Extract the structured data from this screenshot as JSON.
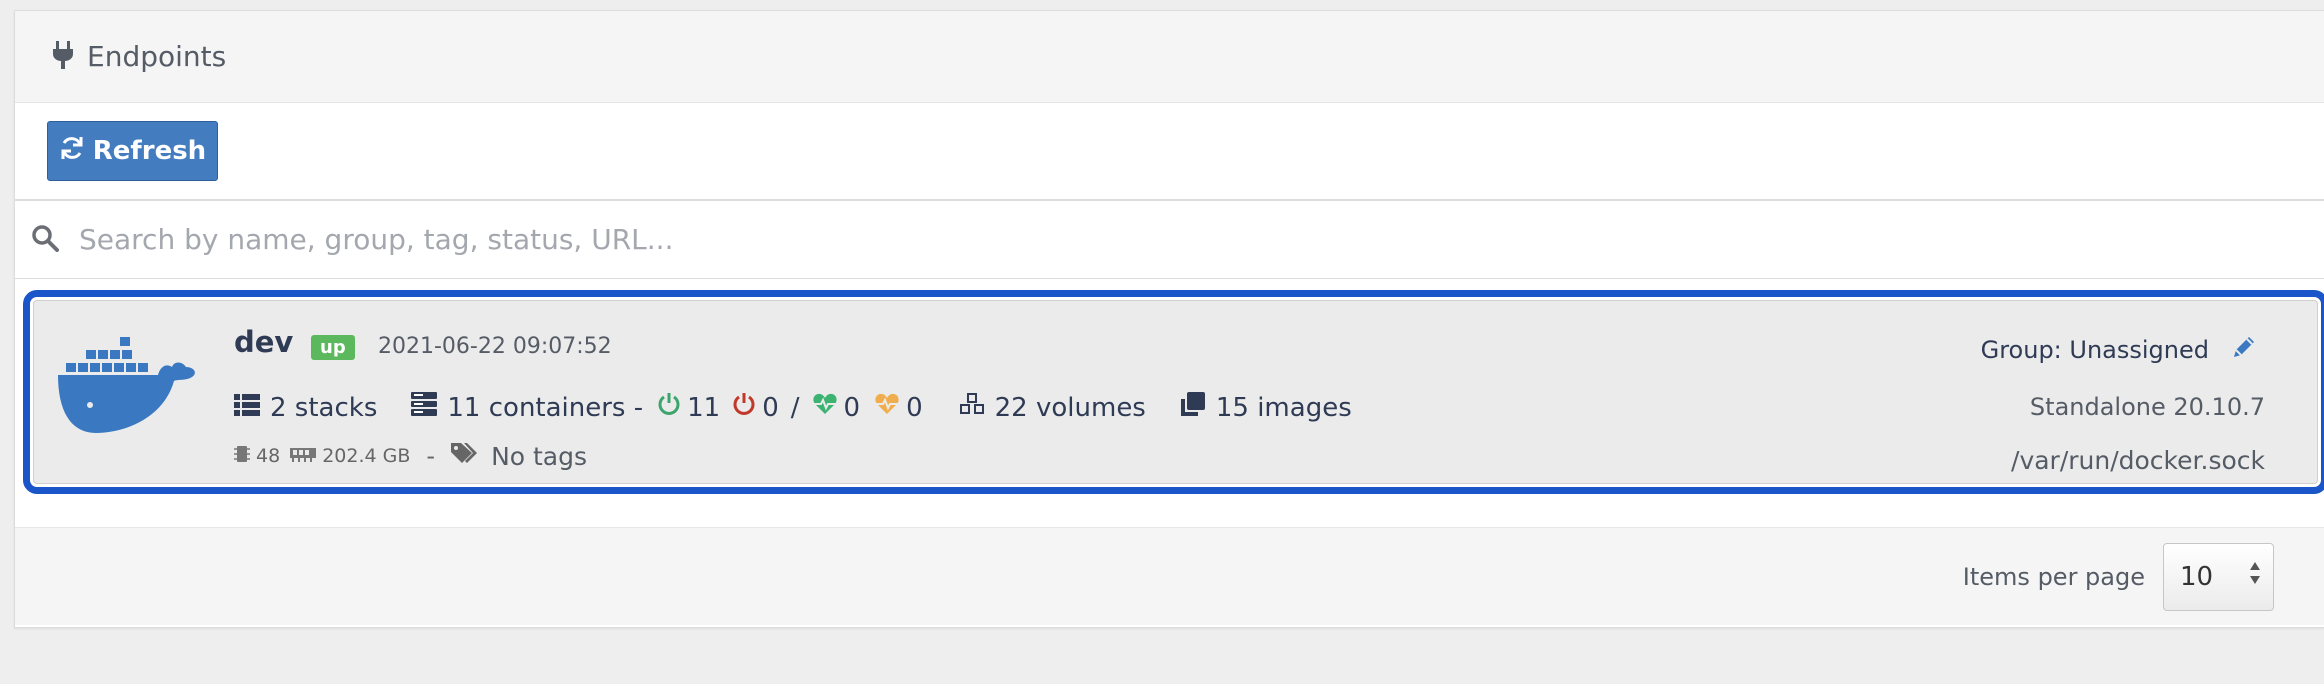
{
  "header": {
    "title": "Endpoints",
    "icon": "plug-icon"
  },
  "toolbar": {
    "refresh_label": "Refresh"
  },
  "search": {
    "placeholder": "Search by name, group, tag, status, URL..."
  },
  "endpoint": {
    "name": "dev",
    "status": "up",
    "timestamp": "2021-06-22 09:07:52",
    "stacks": "2 stacks",
    "containers": "11 containers -",
    "running": "11",
    "stopped": "0",
    "separator": "/",
    "healthy": "0",
    "unhealthy": "0",
    "volumes": "22 volumes",
    "images": "15 images",
    "cpu": "48",
    "memory": "202.4 GB",
    "dash": "-",
    "tags": "No tags",
    "group": "Group: Unassigned",
    "type": "Standalone 20.10.7",
    "url": "/var/run/docker.sock"
  },
  "footer": {
    "items_per_page_label": "Items per page",
    "items_per_page_value": "10"
  },
  "colors": {
    "accent": "#447cc0",
    "selection": "#1a56c9",
    "up": "#5cb85c",
    "running": "#3ca56c",
    "stopped": "#c0392b",
    "healthy": "#3cb371",
    "unhealthy": "#f0ad4e"
  }
}
